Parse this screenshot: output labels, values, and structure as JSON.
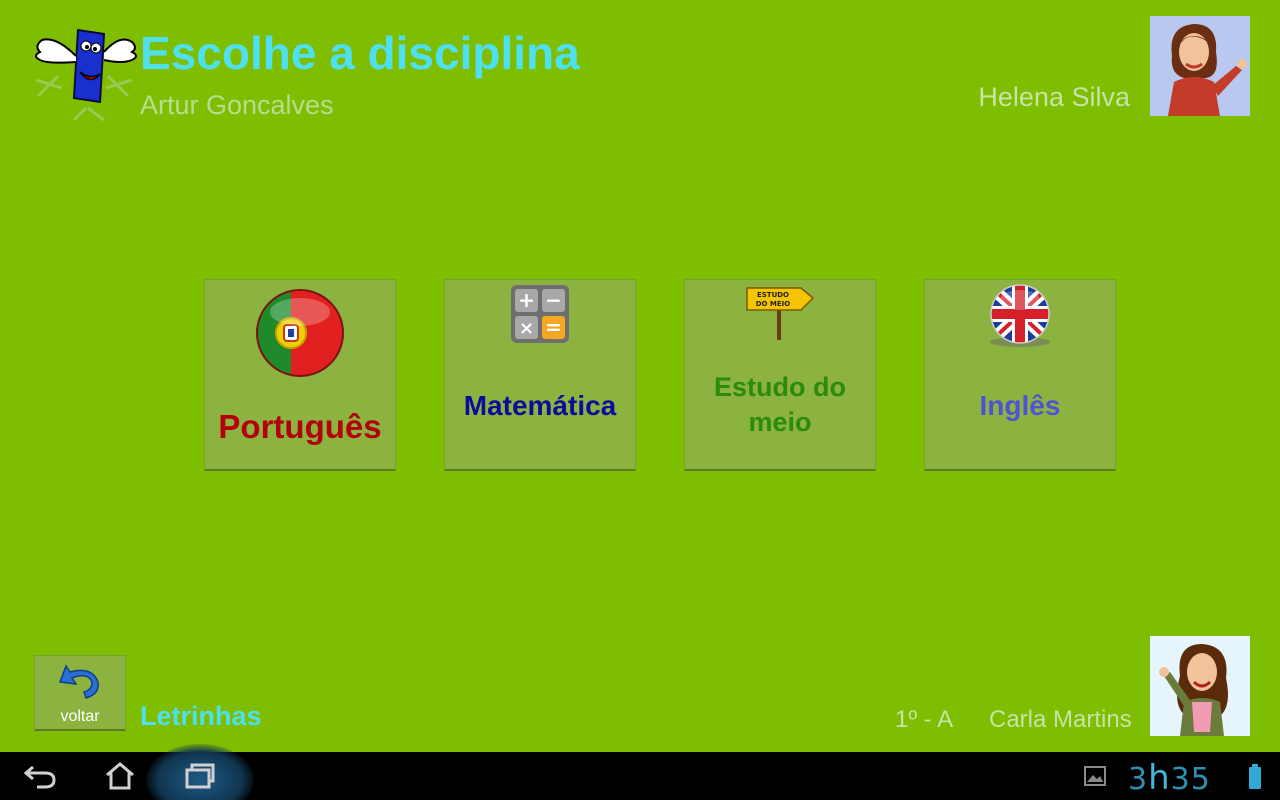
{
  "header": {
    "title": "Escolhe a disciplina",
    "student_name": "Artur Goncalves",
    "teacher_name": "Helena Silva"
  },
  "subjects": [
    {
      "label": "Português",
      "icon": "portugal-flag-icon",
      "color": "#b3000a"
    },
    {
      "label": "Matemática",
      "icon": "calculator-icon",
      "color": "#0a0c9a"
    },
    {
      "label": "Estudo do meio",
      "icon": "signpost-icon",
      "icon_text": "ESTUDO DO MEIO",
      "color": "#2b8b0c"
    },
    {
      "label": "Inglês",
      "icon": "uk-flag-icon",
      "color": "#5151d4"
    }
  ],
  "footer": {
    "back_label": "voltar",
    "app_name": "Letrinhas",
    "class_label": "1º - A",
    "teacher_name": "Carla Martins"
  },
  "system_bar": {
    "clock_hours": "3",
    "clock_sep": "h",
    "clock_minutes": "35"
  },
  "colors": {
    "background": "#7fbd00",
    "tile": "#8cb33f",
    "accent": "#4fe0f0"
  }
}
